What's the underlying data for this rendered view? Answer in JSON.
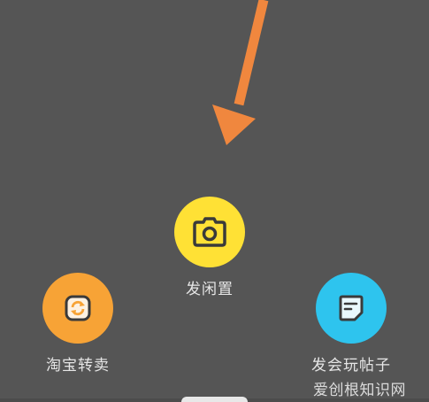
{
  "actions": {
    "idle": {
      "label": "发闲置",
      "icon": "camera-icon",
      "color": "#FFE135"
    },
    "resell": {
      "label": "淘宝转卖",
      "icon": "refresh-icon",
      "color": "#F7A336"
    },
    "post": {
      "label": "发会玩帖子",
      "icon": "note-icon",
      "color": "#2EC4EE"
    }
  },
  "annotation": {
    "icon": "arrow-down-icon",
    "color": "#F0873E"
  },
  "watermark": {
    "text": "爱创根知识网"
  }
}
